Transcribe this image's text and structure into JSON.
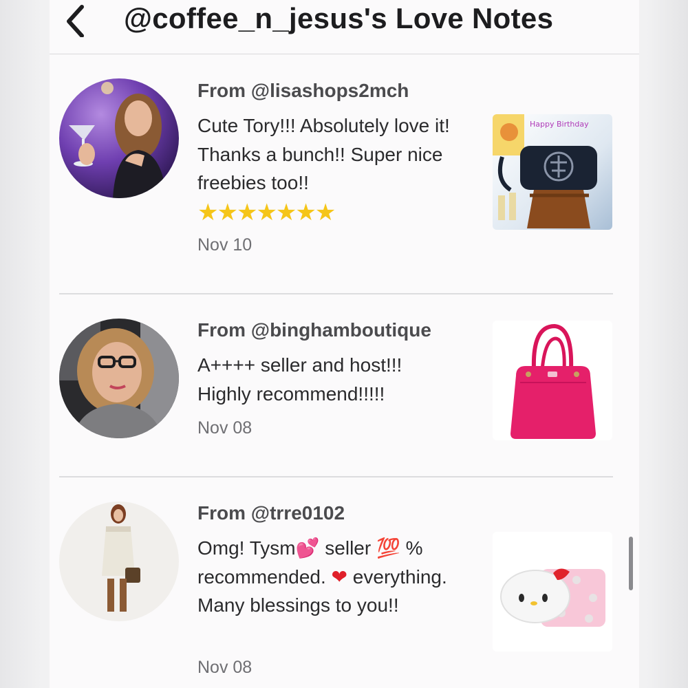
{
  "header": {
    "title": "@coffee_n_jesus's Love Notes",
    "back_icon": "chevron-left-icon"
  },
  "notes": [
    {
      "from": "From @lisashops2mch",
      "message": "Cute Tory!!! Absolutely love it! Thanks a bunch!! Super nice freebies too!!",
      "stars": "★★★★★★★",
      "date": "Nov 10",
      "thumbnail_caption": "Happy Birthday"
    },
    {
      "from": "From @binghamboutique",
      "message": "A++++ seller and host!!! Highly recommend!!!!!",
      "date": "Nov 08"
    },
    {
      "from": "From @trre0102",
      "message_part1": "Omg! Tysm",
      "emoji_hearts": "💕",
      "message_part2": " seller ",
      "emoji_100": "💯",
      "message_part3": " % recommended. ",
      "emoji_heart": "❤",
      "message_part4": " everything. Many blessings to you!!",
      "date": "Nov 08"
    }
  ],
  "colors": {
    "stars": "#f5c518",
    "hundred": "#e0282e",
    "heart": "#e0202a",
    "hearts": "#f25ea8"
  }
}
